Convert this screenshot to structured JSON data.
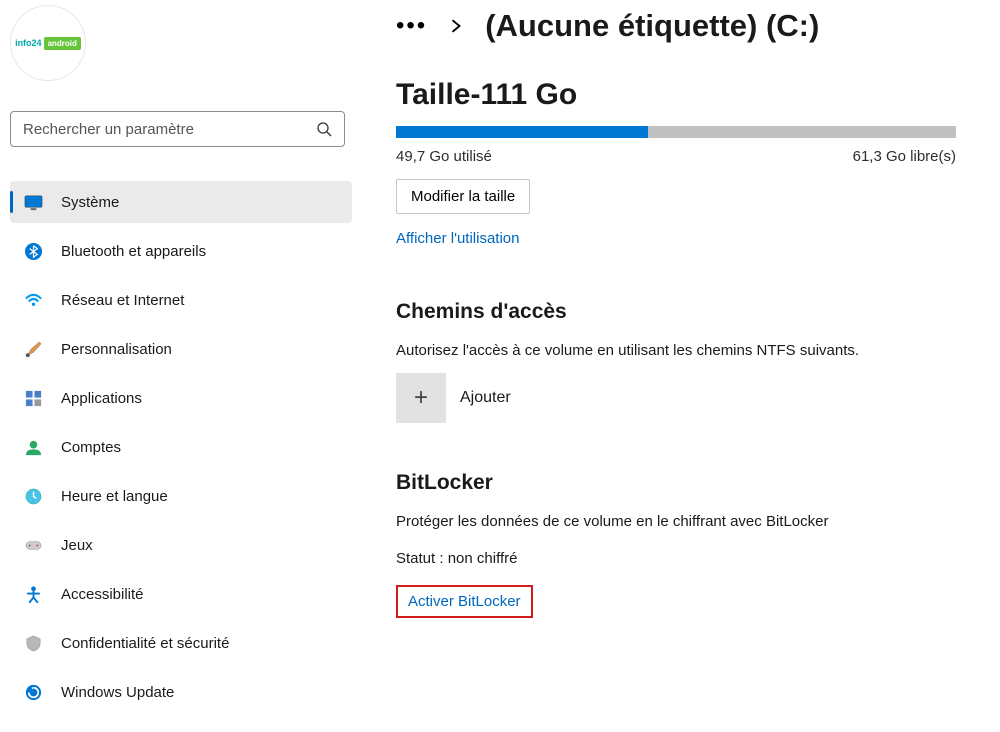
{
  "search": {
    "placeholder": "Rechercher un paramètre"
  },
  "sidebar": {
    "items": [
      {
        "label": "Système"
      },
      {
        "label": "Bluetooth et appareils"
      },
      {
        "label": "Réseau et Internet"
      },
      {
        "label": "Personnalisation"
      },
      {
        "label": "Applications"
      },
      {
        "label": "Comptes"
      },
      {
        "label": "Heure et langue"
      },
      {
        "label": "Jeux"
      },
      {
        "label": "Accessibilité"
      },
      {
        "label": "Confidentialité et sécurité"
      },
      {
        "label": "Windows Update"
      }
    ]
  },
  "breadcrumb": {
    "title": "(Aucune étiquette) (C:)"
  },
  "size": {
    "heading": "Taille-111 Go",
    "used": "49,7 Go utilisé",
    "free": "61,3 Go libre(s)",
    "used_percent": 45,
    "modify_label": "Modifier la taille",
    "show_usage": "Afficher l'utilisation"
  },
  "paths": {
    "heading": "Chemins d'accès",
    "desc": "Autorisez l'accès à ce volume en utilisant les chemins NTFS suivants.",
    "add_label": "Ajouter"
  },
  "bitlocker": {
    "heading": "BitLocker",
    "desc": "Protéger les données de ce volume en le chiffrant avec BitLocker",
    "status": "Statut : non chiffré",
    "activate": "Activer BitLocker"
  }
}
